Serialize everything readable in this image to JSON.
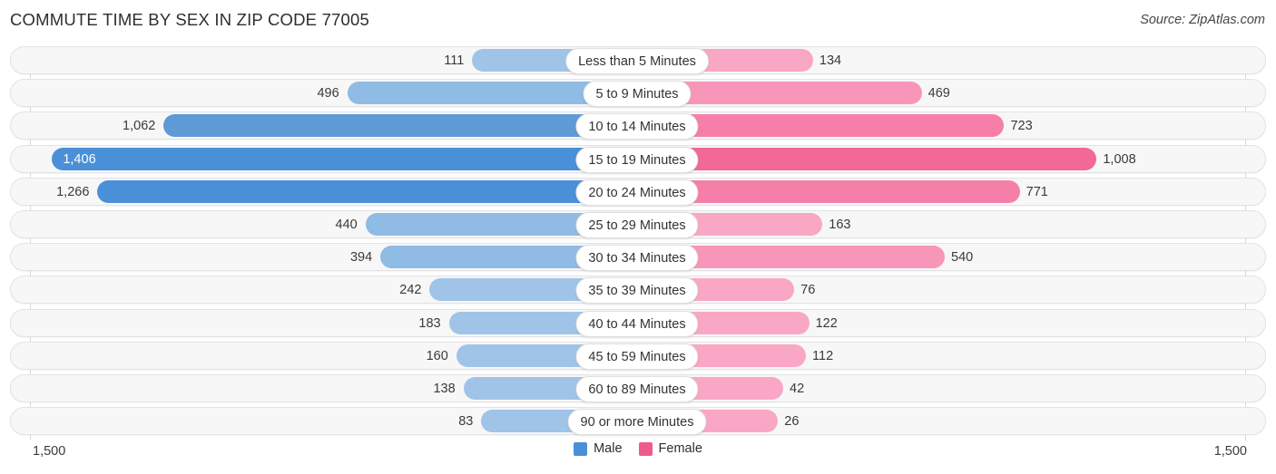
{
  "header": {
    "title": "COMMUTE TIME BY SEX IN ZIP CODE 77005",
    "source": "Source: ZipAtlas.com"
  },
  "axis": {
    "left_max_label": "1,500",
    "right_max_label": "1,500"
  },
  "legend": {
    "male_label": "Male",
    "female_label": "Female",
    "male_color": "#4a90d9",
    "female_color": "#ef5a8c"
  },
  "chart_data": {
    "type": "bar",
    "orientation": "horizontal-diverging",
    "title": "COMMUTE TIME BY SEX IN ZIP CODE 77005",
    "subtitle": "",
    "xlabel": "",
    "ylabel": "",
    "xlim": [
      1500,
      1500
    ],
    "grid": true,
    "legend_position": "bottom-center",
    "categories": [
      "Less than 5 Minutes",
      "5 to 9 Minutes",
      "10 to 14 Minutes",
      "15 to 19 Minutes",
      "20 to 24 Minutes",
      "25 to 29 Minutes",
      "30 to 34 Minutes",
      "35 to 39 Minutes",
      "40 to 44 Minutes",
      "45 to 59 Minutes",
      "60 to 89 Minutes",
      "90 or more Minutes"
    ],
    "series": [
      {
        "name": "Male",
        "color": "#4a90d9",
        "values": [
          111,
          496,
          1062,
          1406,
          1266,
          440,
          394,
          242,
          183,
          160,
          138,
          83
        ],
        "labels": [
          "111",
          "496",
          "1,062",
          "1,406",
          "1,266",
          "440",
          "394",
          "242",
          "183",
          "160",
          "138",
          "83"
        ]
      },
      {
        "name": "Female",
        "color": "#ef5a8c",
        "values": [
          134,
          469,
          723,
          1008,
          771,
          163,
          540,
          76,
          122,
          112,
          42,
          26
        ],
        "labels": [
          "134",
          "469",
          "723",
          "1,008",
          "771",
          "163",
          "540",
          "76",
          "122",
          "112",
          "42",
          "26"
        ]
      }
    ]
  }
}
